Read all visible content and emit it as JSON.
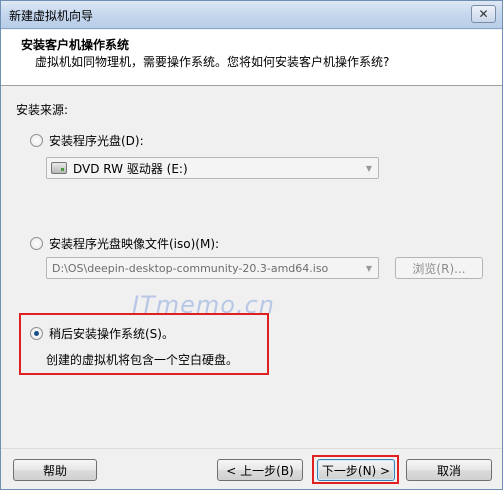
{
  "window": {
    "title": "新建虚拟机向导",
    "close_glyph": "✕"
  },
  "header": {
    "title": "安装客户机操作系统",
    "subtitle": "虚拟机如同物理机，需要操作系统。您将如何安装客户机操作系统?"
  },
  "install_source": {
    "label": "安装来源:",
    "options": [
      {
        "label": "安装程序光盘(D):",
        "selected": false
      },
      {
        "label": "安装程序光盘映像文件(iso)(M):",
        "selected": false
      },
      {
        "label": "稍后安装操作系统(S)。",
        "selected": true
      }
    ],
    "disc_combo_value": "DVD RW 驱动器 (E:)",
    "iso_combo_value": "D:\\OS\\deepin-desktop-community-20.3-amd64.iso",
    "browse_label": "浏览(R)...",
    "later_note": "创建的虚拟机将包含一个空白硬盘。"
  },
  "watermark": "ITmemo.cn",
  "footer": {
    "help_label": "帮助",
    "back_label": "< 上一步(B)",
    "next_label": "下一步(N) >",
    "cancel_label": "取消"
  },
  "colors": {
    "highlight_box": "#e02020",
    "title_bar": "#c7d8ee",
    "watermark": "#b8c7e6"
  },
  "icons": {
    "disc_drive": "dvd-drive-icon",
    "close": "close-icon",
    "dropdown": "chevron-down-icon"
  }
}
